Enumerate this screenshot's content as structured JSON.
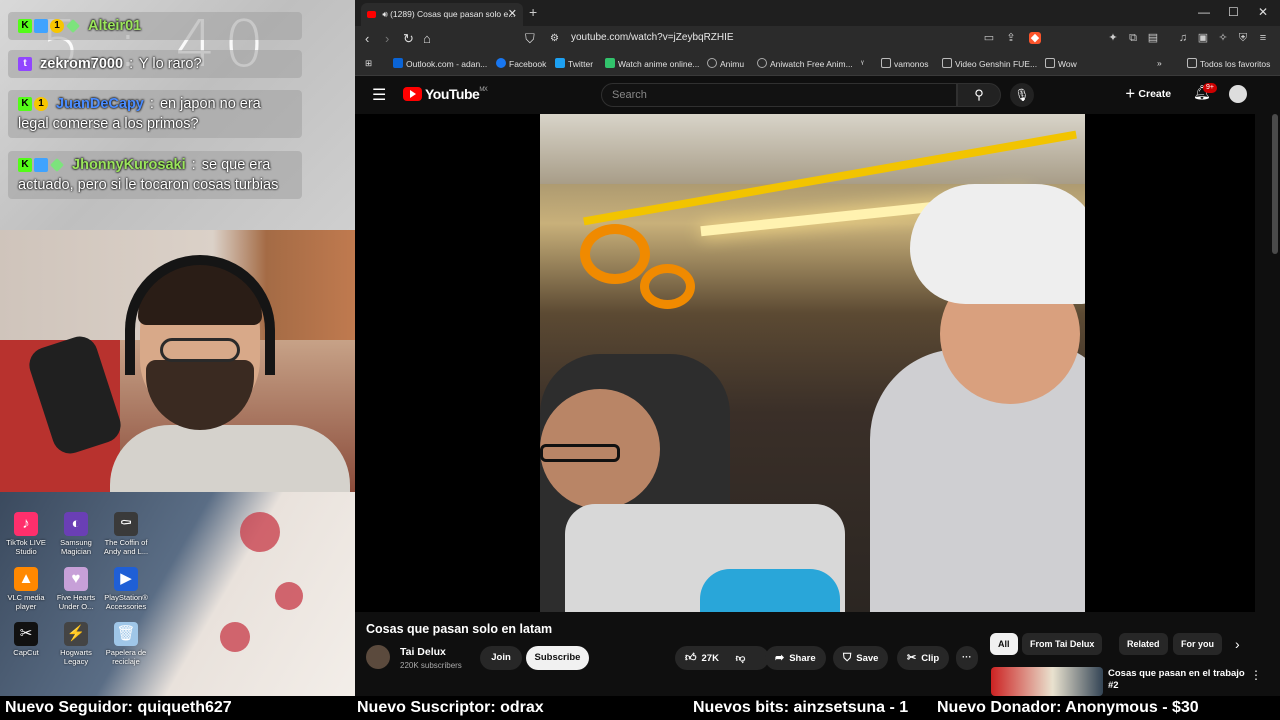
{
  "overlay": {
    "clock": "5 : 40",
    "chat": [
      {
        "user": "Alteir01",
        "text": "",
        "badges": [
          "kick",
          "sub",
          "one",
          "diamond"
        ],
        "color": "#9be55c"
      },
      {
        "user": "zekrom7000",
        "text": "Y lo raro?",
        "badges": [
          "twitch"
        ],
        "color": "#ffffff"
      },
      {
        "user": "JuanDeCapy",
        "text": "en japon no era legal comerse a los primos?",
        "badges": [
          "kick",
          "one"
        ],
        "color": "#4a8cff"
      },
      {
        "user": "JhonnyKurosaki",
        "text": "se que era actuado, pero si le tocaron cosas turbias",
        "badges": [
          "kick",
          "sub",
          "diamond"
        ],
        "color": "#9be55c"
      }
    ],
    "chat_separator": ":",
    "desktop_icons": [
      {
        "label": "TikTok LIVE Studio",
        "icon": "tiktok-icon",
        "color": "#ff2f6c"
      },
      {
        "label": "Samsung Magician",
        "icon": "samsung-magician-icon",
        "color": "#6a3fb5"
      },
      {
        "label": "The Coffin of Andy and L...",
        "icon": "game-icon",
        "color": "#3a3a3a"
      },
      {
        "label": "VLC media player",
        "icon": "vlc-icon",
        "color": "#ff8800"
      },
      {
        "label": "Five Hearts Under O...",
        "icon": "game-icon",
        "color": "#c7a0d8"
      },
      {
        "label": "PlayStation® Accessories",
        "icon": "playstation-icon",
        "color": "#1f5fd6"
      },
      {
        "label": "CapCut",
        "icon": "capcut-icon",
        "color": "#111111"
      },
      {
        "label": "Hogwarts Legacy",
        "icon": "game-icon",
        "color": "#444444"
      },
      {
        "label": "Papelera de reciclaje",
        "icon": "recycle-bin-icon",
        "color": "#9fc6e8"
      }
    ]
  },
  "ticker": {
    "follower": "Nuevo Seguidor: quiqueth627",
    "subscriber": "Nuevo Suscriptor: odrax",
    "bits": "Nuevos bits: ainzsetsuna - 1",
    "donor": "Nuevo Donador: Anonymous - $30"
  },
  "browser": {
    "tab_title": "(1289) Cosas que pasan solo e...",
    "url": "youtube.com/watch?v=jZeybqRZHIE",
    "bookmarks": [
      {
        "label": "Outlook.com - adan...",
        "icon": "outlook-icon",
        "color": "#0a64d6"
      },
      {
        "label": "Facebook",
        "icon": "facebook-icon",
        "color": "#1877f2"
      },
      {
        "label": "Twitter",
        "icon": "twitter-icon",
        "color": "#1da1f2"
      },
      {
        "label": "Watch anime online...",
        "icon": "anime-icon",
        "color": "#32c36c"
      },
      {
        "label": "Animu",
        "icon": "animu-icon",
        "color": "#888888"
      },
      {
        "label": "Aniwatch Free Anim...",
        "icon": "aniwatch-icon",
        "color": "#888888"
      },
      {
        "label": "vamonos",
        "icon": "folder-icon",
        "color": "#888888"
      },
      {
        "label": "Video Genshin FUE...",
        "icon": "folder-icon",
        "color": "#888888"
      },
      {
        "label": "Wow",
        "icon": "folder-icon",
        "color": "#888888"
      }
    ],
    "all_bookmarks": "Todos los favoritos"
  },
  "youtube": {
    "logo": "YouTube",
    "region": "MX",
    "search_placeholder": "Search",
    "create_label": "Create",
    "notif_count": "9+",
    "video_title": "Cosas que pasan solo en latam",
    "channel_name": "Tai Delux",
    "channel_subs": "220K subscribers",
    "join_label": "Join",
    "subscribe_label": "Subscribe",
    "likes": "27K",
    "share_label": "Share",
    "save_label": "Save",
    "clip_label": "Clip",
    "chips": [
      "All",
      "From Tai Delux",
      "Related",
      "For you"
    ],
    "rec_title": "Cosas que pasan en el trabajo #2",
    "brand_color": "#ff0000"
  }
}
